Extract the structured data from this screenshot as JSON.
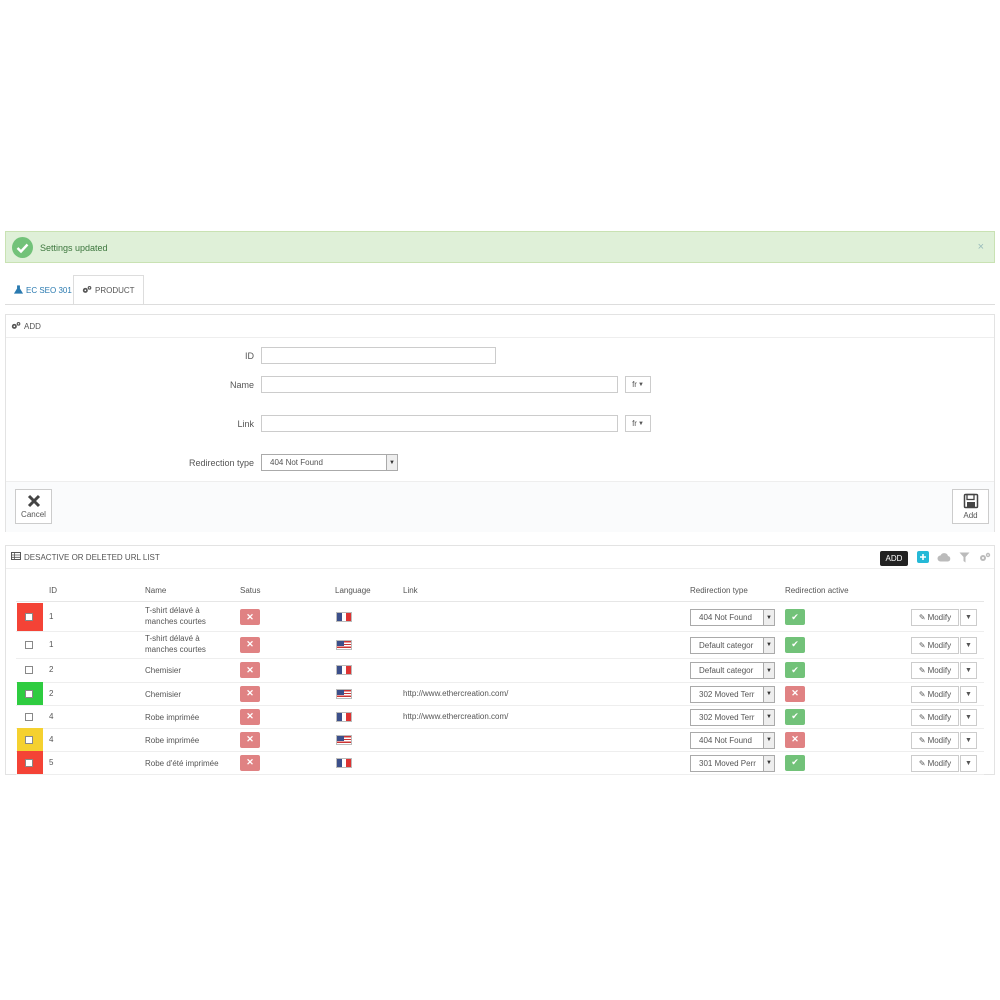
{
  "alert": {
    "message": "Settings updated",
    "close": "×"
  },
  "tabs": [
    {
      "label": "EC SEO 301"
    },
    {
      "label": "PRODUCT"
    }
  ],
  "add_panel": {
    "title": "ADD",
    "fields": {
      "id_label": "ID",
      "name_label": "Name",
      "link_label": "Link",
      "redirection_label": "Redirection type",
      "name_lang": "fr",
      "link_lang": "fr",
      "redirection_value": "404 Not Found"
    },
    "cancel_label": "Cancel",
    "add_label": "Add"
  },
  "list_panel": {
    "title": "DESACTIVE OR DELETED URL LIST",
    "tooltip": "ADD",
    "columns": {
      "id": "ID",
      "name": "Name",
      "status": "Satus",
      "language": "Language",
      "link": "Link",
      "redirection_type": "Redirection type",
      "redirection_active": "Redirection active"
    },
    "rows": [
      {
        "id": "1",
        "name": "T-shirt délavé à manches courtes",
        "language": "fr",
        "link": "",
        "redirection": "404 Not Found",
        "active": true,
        "indicator": "#f44336",
        "modify": "Modify"
      },
      {
        "id": "1",
        "name": "T-shirt délavé à manches courtes",
        "language": "us",
        "link": "",
        "redirection": "Default categor",
        "active": true,
        "indicator": "",
        "modify": "Modify"
      },
      {
        "id": "2",
        "name": "Chemisier",
        "language": "fr",
        "link": "",
        "redirection": "Default categor",
        "active": true,
        "indicator": "",
        "modify": "Modify"
      },
      {
        "id": "2",
        "name": "Chemisier",
        "language": "us",
        "link": "http://www.ethercreation.com/",
        "redirection": "302 Moved Terr",
        "active": false,
        "indicator": "#2ecc40",
        "modify": "Modify"
      },
      {
        "id": "4",
        "name": "Robe imprimée",
        "language": "fr",
        "link": "http://www.ethercreation.com/",
        "redirection": "302 Moved Terr",
        "active": true,
        "indicator": "",
        "modify": "Modify"
      },
      {
        "id": "4",
        "name": "Robe imprimée",
        "language": "us",
        "link": "",
        "redirection": "404 Not Found",
        "active": false,
        "indicator": "#f5d130",
        "modify": "Modify"
      },
      {
        "id": "5",
        "name": "Robe d'été imprimée",
        "language": "fr",
        "link": "",
        "redirection": "301 Moved Perr",
        "active": true,
        "indicator": "#f44336",
        "modify": "Modify"
      }
    ]
  },
  "colors": {
    "success": "#72c279",
    "danger": "#e08283",
    "accent": "#2a7ab0"
  }
}
